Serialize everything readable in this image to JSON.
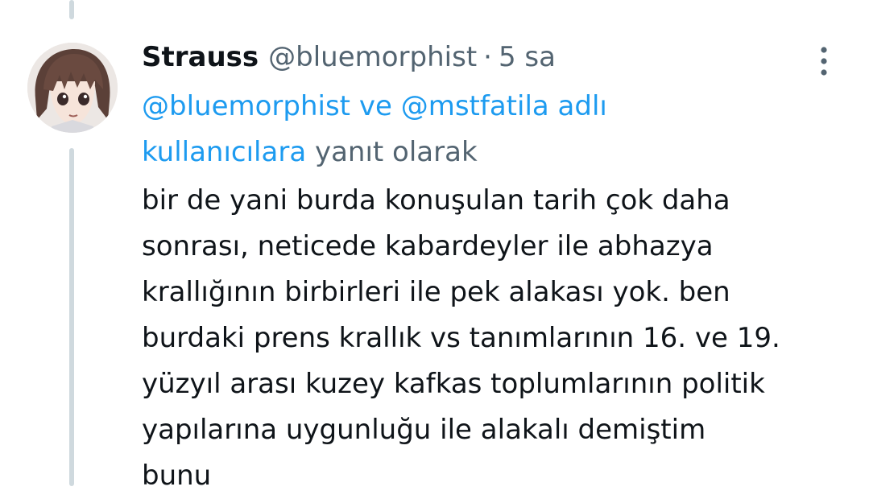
{
  "tweet": {
    "author": {
      "display_name": "Strauss",
      "handle": "@bluemorphist",
      "avatar_icon": "anime-avatar"
    },
    "separator": "·",
    "time": "5 sa",
    "more_icon": "more-vertical-icon",
    "reply_context": {
      "mention_1": "@bluemorphist",
      "connector": "ve",
      "mention_2": "@mstfatila",
      "mention_2_suffix": "adlı",
      "users_label": "kullanıcılara",
      "suffix": "yanıt olarak"
    },
    "text_lines": [
      "bir de yani burda konuşulan tarih çok daha",
      "sonrası, neticede kabardeyler ile abhazya",
      "krallığının birbirleri ile pek alakası yok. ben",
      "burdaki prens krallık vs tanımlarının 16. ve 19.",
      "yüzyıl arası kuzey kafkas toplumlarının politik",
      "yapılarına uygunluğu ile alakalı demiştim",
      "bunu"
    ]
  },
  "colors": {
    "text_primary": "#0f1419",
    "text_secondary": "#536471",
    "link": "#1d9bf0",
    "thread_line": "#cfd9de"
  }
}
